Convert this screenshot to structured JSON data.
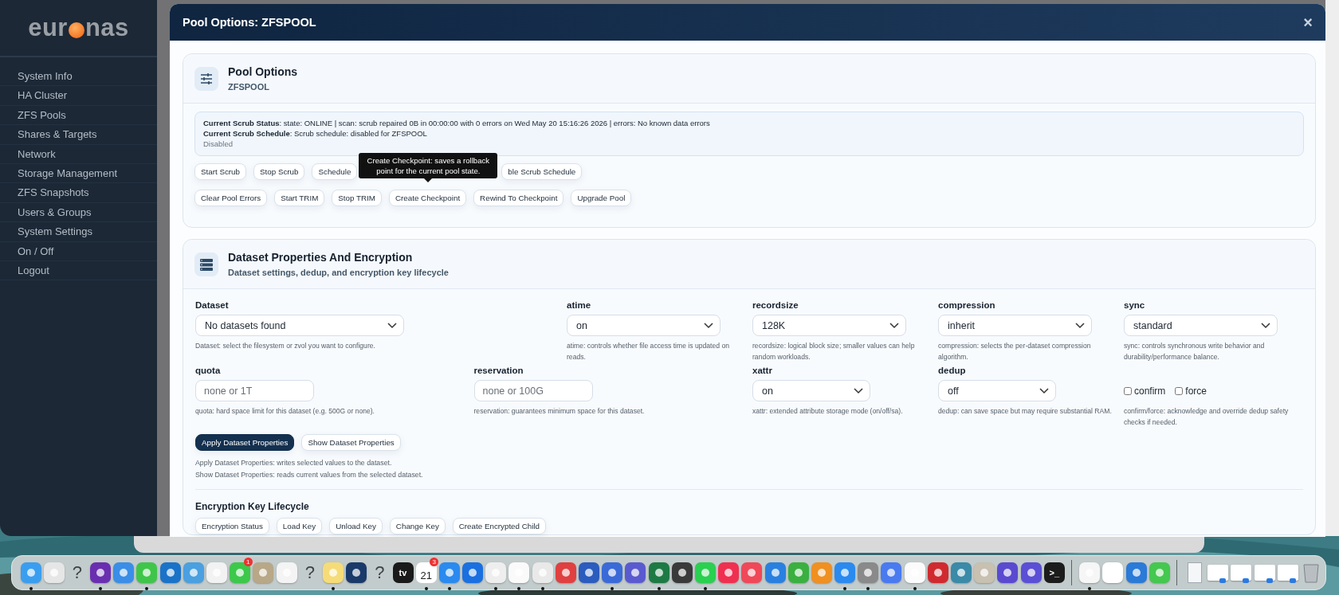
{
  "sidebar": {
    "logo_start": "eur",
    "logo_end": "nas",
    "items": [
      {
        "label": "System Info"
      },
      {
        "label": "HA Cluster"
      },
      {
        "label": "ZFS Pools"
      },
      {
        "label": "Shares & Targets"
      },
      {
        "label": "Network"
      },
      {
        "label": "Storage Management"
      },
      {
        "label": "ZFS Snapshots"
      },
      {
        "label": "Users & Groups"
      },
      {
        "label": "System Settings"
      },
      {
        "label": "On / Off"
      },
      {
        "label": "Logout"
      }
    ]
  },
  "modal": {
    "title": "Pool Options: ZFSPOOL",
    "close": "×"
  },
  "pool_card": {
    "title": "Pool Options",
    "subtitle": "ZFSPOOL",
    "status_lines": [
      "**Current Scrub Status**: state: ONLINE | scan: scrub repaired 0B in 00:00:00 with 0 errors on Wed May 20 15:16:26 2026 | errors: No known data errors",
      "**Current Scrub Schedule**: Scrub schedule: disabled for ZFSPOOL"
    ],
    "status_note": "Disabled",
    "button_rows": [
      [
        "Start Scrub",
        "Stop Scrub",
        "Schedule",
        "ble Scrub Schedule"
      ],
      [
        "Clear Pool Errors",
        "Start TRIM",
        "Stop TRIM",
        "Create Checkpoint",
        "Rewind To Checkpoint",
        "Upgrade Pool"
      ]
    ],
    "tooltip": {
      "text": "Create Checkpoint: saves a rollback point for the current pool state."
    }
  },
  "dataset_card": {
    "title": "Dataset Properties And Encryption",
    "subtitle": "Dataset settings, dedup, and encryption key lifecycle",
    "fields": [
      {
        "kind": "select",
        "label": "Dataset",
        "value": "No datasets found",
        "help": "Dataset: select the filesystem or zvol you want to configure."
      },
      {
        "kind": "select",
        "label": "atime",
        "value": "on",
        "help": "atime: controls whether file access time is updated on reads."
      },
      {
        "kind": "select",
        "label": "recordsize",
        "value": "128K",
        "help": "recordsize: logical block size; smaller values can help random workloads."
      },
      {
        "kind": "select",
        "label": "compression",
        "value": "inherit",
        "help": "compression: selects the per-dataset compression algorithm."
      },
      {
        "kind": "select",
        "label": "sync",
        "value": "standard",
        "help": "sync: controls synchronous write behavior and durability/performance balance."
      },
      {
        "kind": "input",
        "label": "quota",
        "placeholder": "none or 1T",
        "help": "quota: hard space limit for this dataset (e.g. 500G or none)."
      },
      {
        "kind": "input",
        "label": "reservation",
        "placeholder": "none or 100G",
        "help": "reservation: guarantees minimum space for this dataset."
      },
      {
        "kind": "select",
        "label": "xattr",
        "value": "on",
        "help": "xattr: extended attribute storage mode (on/off/sa)."
      },
      {
        "kind": "select",
        "label": "dedup",
        "value": "off",
        "help": "dedup: can save space but may require substantial RAM."
      },
      {
        "kind": "checks",
        "checks": [
          {
            "label": "confirm",
            "checked": false
          },
          {
            "label": "force",
            "checked": false
          }
        ],
        "help": "confirm/force: acknowledge and override dedup safety checks if needed."
      }
    ],
    "buttons": [
      {
        "label": "Apply Dataset Properties",
        "primary": true
      },
      {
        "label": "Show Dataset Properties",
        "primary": false
      }
    ],
    "notes": [
      "Apply Dataset Properties: writes selected values to the dataset.",
      "Show Dataset Properties: reads current values from the selected dataset."
    ],
    "encryption": {
      "title": "Encryption Key Lifecycle",
      "buttons": [
        "Encryption Status",
        "Load Key",
        "Unload Key",
        "Change Key",
        "Create Encrypted Child"
      ]
    }
  },
  "dock": {
    "items": [
      {
        "kind": "app",
        "color": "#3a9ef0",
        "running": true
      },
      {
        "kind": "app",
        "color": "#e6e6e6",
        "running": false
      },
      {
        "kind": "unknown",
        "label": "?",
        "running": false
      },
      {
        "kind": "app",
        "color": "#6a2fb0",
        "running": true
      },
      {
        "kind": "app",
        "color": "#3a8ee8",
        "running": false
      },
      {
        "kind": "app",
        "color": "#3fc64a",
        "running": true
      },
      {
        "kind": "app",
        "color": "#1a73c8",
        "running": false
      },
      {
        "kind": "app",
        "color": "#4aa0e0",
        "running": false
      },
      {
        "kind": "app",
        "color": "#f2f2f2",
        "running": false
      },
      {
        "kind": "app",
        "color": "#3cc84a",
        "badge": "1",
        "running": false
      },
      {
        "kind": "app",
        "color": "#b8a888",
        "running": false
      },
      {
        "kind": "app",
        "color": "#f4f4f4",
        "running": false
      },
      {
        "kind": "unknown",
        "label": "?",
        "running": false
      },
      {
        "kind": "app",
        "color": "#f6dc78",
        "running": true
      },
      {
        "kind": "app",
        "color": "#1a3a6a",
        "running": false
      },
      {
        "kind": "unknown",
        "label": "?",
        "running": false
      },
      {
        "kind": "text",
        "label": "tv",
        "color": "#1a1a1a",
        "running": false
      },
      {
        "kind": "calendar",
        "label": "21",
        "badge": "3",
        "running": true
      },
      {
        "kind": "app",
        "color": "#2a8af0",
        "running": true
      },
      {
        "kind": "app",
        "color": "#1a70e0",
        "running": false
      },
      {
        "kind": "app",
        "color": "#eeeeee",
        "running": true
      },
      {
        "kind": "app",
        "color": "#fafafa",
        "running": true
      },
      {
        "kind": "app",
        "color": "#e9e9e9",
        "running": true
      },
      {
        "kind": "app",
        "color": "#e04040",
        "running": false
      },
      {
        "kind": "app",
        "color": "#2b5cbe",
        "running": false
      },
      {
        "kind": "app",
        "color": "#3a6ad8",
        "running": true
      },
      {
        "kind": "app",
        "color": "#5a5ad0",
        "running": false
      },
      {
        "kind": "app",
        "color": "#1e7a44",
        "running": true
      },
      {
        "kind": "app",
        "color": "#3a3a3a",
        "running": false
      },
      {
        "kind": "app",
        "color": "#2ad050",
        "running": true
      },
      {
        "kind": "app",
        "color": "#f03050",
        "running": false
      },
      {
        "kind": "app",
        "color": "#f04858",
        "running": false
      },
      {
        "kind": "app",
        "color": "#2a80e0",
        "running": false
      },
      {
        "kind": "app",
        "color": "#3ab040",
        "running": false
      },
      {
        "kind": "app",
        "color": "#f09020",
        "running": false
      },
      {
        "kind": "app",
        "color": "#2a8af0",
        "running": true
      },
      {
        "kind": "app",
        "color": "#8a8a8a",
        "running": true
      },
      {
        "kind": "app",
        "color": "#4a7af0",
        "running": false
      },
      {
        "kind": "app",
        "color": "#fbfbfb",
        "running": true
      },
      {
        "kind": "app",
        "color": "#d02a30",
        "running": false
      },
      {
        "kind": "app",
        "color": "#3a8aa8",
        "running": false
      },
      {
        "kind": "app",
        "color": "#c8c0b0",
        "running": false
      },
      {
        "kind": "app",
        "color": "#5a4ad0",
        "running": false
      },
      {
        "kind": "app",
        "color": "#5b4fd6",
        "running": false
      },
      {
        "kind": "text",
        "label": ">_",
        "color": "#1c1c1c",
        "running": false
      },
      {
        "kind": "separator"
      },
      {
        "kind": "app",
        "color": "#f6f6f6",
        "running": true
      },
      {
        "kind": "app",
        "color": "#ffffff",
        "running": false
      },
      {
        "kind": "app",
        "color": "#2a7ad8",
        "running": false
      },
      {
        "kind": "app",
        "color": "#44c850",
        "running": false
      },
      {
        "kind": "separator"
      },
      {
        "kind": "document"
      },
      {
        "kind": "window"
      },
      {
        "kind": "window"
      },
      {
        "kind": "window"
      },
      {
        "kind": "window"
      },
      {
        "kind": "trash"
      }
    ]
  }
}
